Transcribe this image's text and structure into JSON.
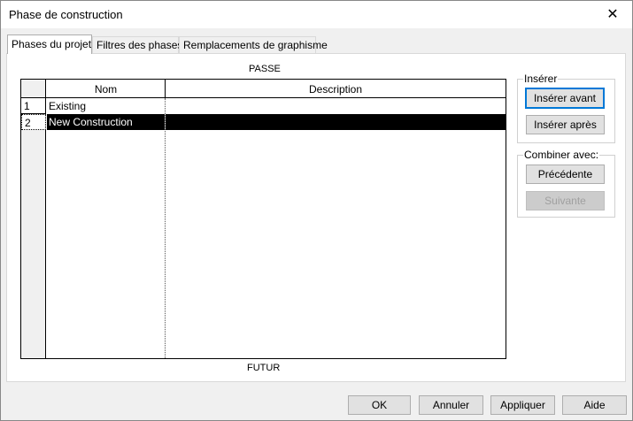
{
  "window": {
    "title": "Phase de construction",
    "close_icon": "close-icon"
  },
  "tabs": [
    {
      "label": "Phases du projet",
      "active": true
    },
    {
      "label": "Filtres des phases",
      "active": false
    },
    {
      "label": "Remplacements de graphisme",
      "active": false
    }
  ],
  "grid": {
    "caption_top": "PASSE",
    "caption_bottom": "FUTUR",
    "columns": [
      "Nom",
      "Description"
    ],
    "rows": [
      {
        "num": "1",
        "name": "Existing",
        "description": "",
        "selected": false
      },
      {
        "num": "2",
        "name": "New Construction",
        "description": "",
        "selected": true
      }
    ]
  },
  "insert_group": {
    "label": "Insérer",
    "before_label": "Insérer avant",
    "after_label": "Insérer après"
  },
  "combine_group": {
    "label": "Combiner avec:",
    "previous_label": "Précédente",
    "next_label": "Suivante"
  },
  "footer": {
    "ok_label": "OK",
    "cancel_label": "Annuler",
    "apply_label": "Appliquer",
    "help_label": "Aide"
  }
}
